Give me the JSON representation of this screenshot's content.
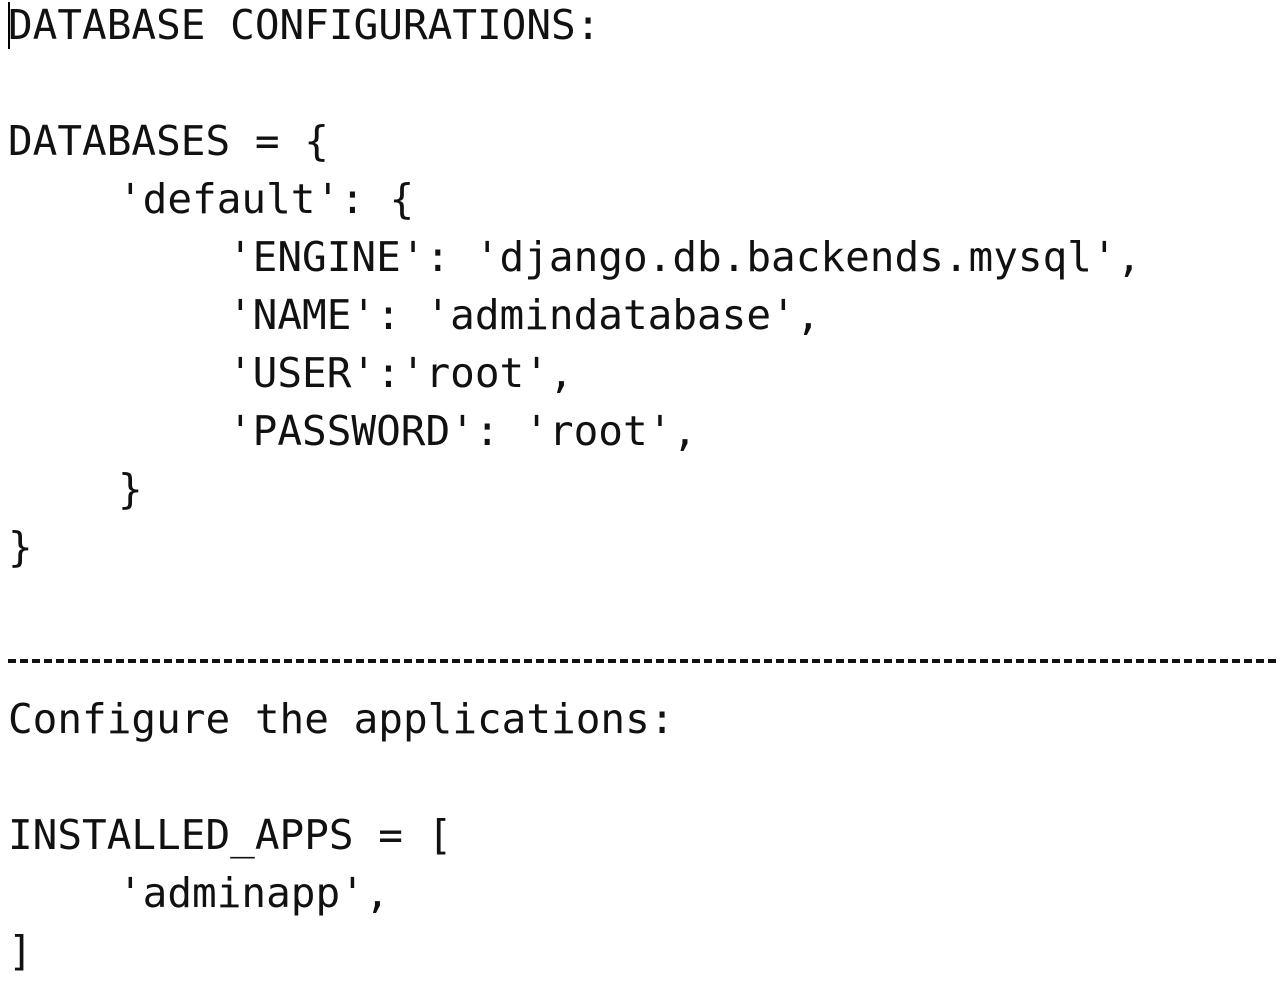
{
  "document": {
    "db_heading": "DATABASE CONFIGURATIONS:",
    "db_lines": [
      "DATABASES = {",
      "'default': {",
      "'ENGINE': 'django.db.backends.mysql',",
      "'NAME': 'admindatabase',",
      "'USER':'root',",
      "'PASSWORD': 'root',",
      "}",
      "}"
    ],
    "app_heading": "Configure the applications:",
    "app_lines": [
      "INSTALLED_APPS = [",
      "'adminapp',",
      "]"
    ]
  }
}
